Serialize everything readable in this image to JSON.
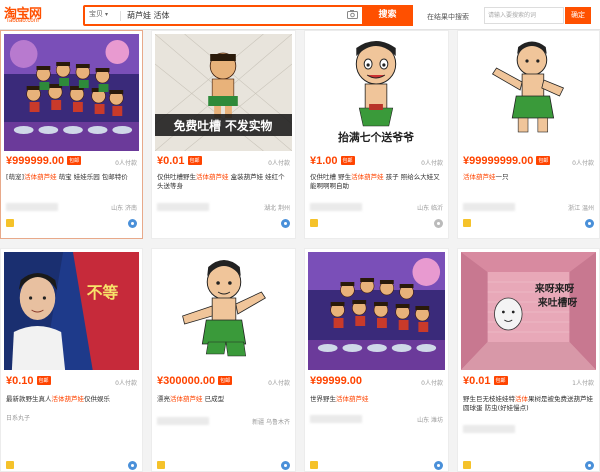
{
  "header": {
    "logo_text": "淘宝网",
    "logo_sub": "Taobao.com",
    "search_scope": "宝贝",
    "search_value": "葫芦娃 活体",
    "search_button": "搜索",
    "shop_search_label": "在结果中搜索",
    "shop_search_placeholder": "请输入要搜索的词",
    "shop_search_button": "确定"
  },
  "colors": {
    "accent": "#ff5000",
    "price": "#ff4400"
  },
  "cards": [
    {
      "price": "¥999999.00",
      "badge": "包邮",
      "sales": "0人付款",
      "title_pre": "[萌宠]",
      "title_hl": "活体葫芦娃",
      "title_post": " 萌宝 娃娃乐园 包邮特价",
      "shop": "",
      "location": "山东 济南"
    },
    {
      "price": "¥0.01",
      "badge": "包邮",
      "sales": "0人付款",
      "title_pre": "仅供吐槽野生",
      "title_hl": "活体葫芦娃",
      "title_post": " 盒装葫芦娃 娃红个头送等身",
      "shop": "",
      "location": "湖北 荆州"
    },
    {
      "price": "¥1.00",
      "badge": "包邮",
      "sales": "0人付款",
      "title_pre": "仅供吐槽 野生",
      "title_hl": "活体葫芦娃",
      "title_post": " 孩子 照给么大娃又能啊啊啊自助",
      "shop": "",
      "location": "山东 临沂"
    },
    {
      "price": "¥99999999.00",
      "badge": "包邮",
      "sales": "0人付款",
      "title_pre": "",
      "title_hl": "活体葫芦娃",
      "title_post": "一只",
      "shop": "",
      "location": "浙江 温州"
    },
    {
      "price": "¥0.10",
      "badge": "包邮",
      "sales": "0人付款",
      "title_pre": "最新款野生真人",
      "title_hl": "活体葫芦娃",
      "title_post": "仅供娱乐",
      "shop": "日系丸子",
      "location": ""
    },
    {
      "price": "¥300000.00",
      "badge": "包邮",
      "sales": "0人付款",
      "title_pre": "漂亮",
      "title_hl": "活体葫芦娃",
      "title_post": " 已成型",
      "shop": "",
      "location": "新疆 乌鲁木齐"
    },
    {
      "price": "¥99999.00",
      "badge": "",
      "sales": "0人付款",
      "title_pre": "世界野生",
      "title_hl": "活体葫芦娃",
      "title_post": "",
      "shop": "",
      "location": "山东 潍坊"
    },
    {
      "price": "¥0.01",
      "badge": "包邮",
      "sales": "1人付款",
      "title_pre": "野生巨无枝娃娃特",
      "title_hl": "活体",
      "title_post": "果树是被免费送葫芦娃 圆球蛋 防虫(好娃慢点)",
      "shop": "",
      "location": ""
    }
  ],
  "thumb_text": {
    "c2": "免费吐槽 不发实物",
    "c3": "抬满七个送爷爷",
    "c5": "不等",
    "c8_line1": "来呀来呀",
    "c8_line2": "来吐槽呀"
  }
}
